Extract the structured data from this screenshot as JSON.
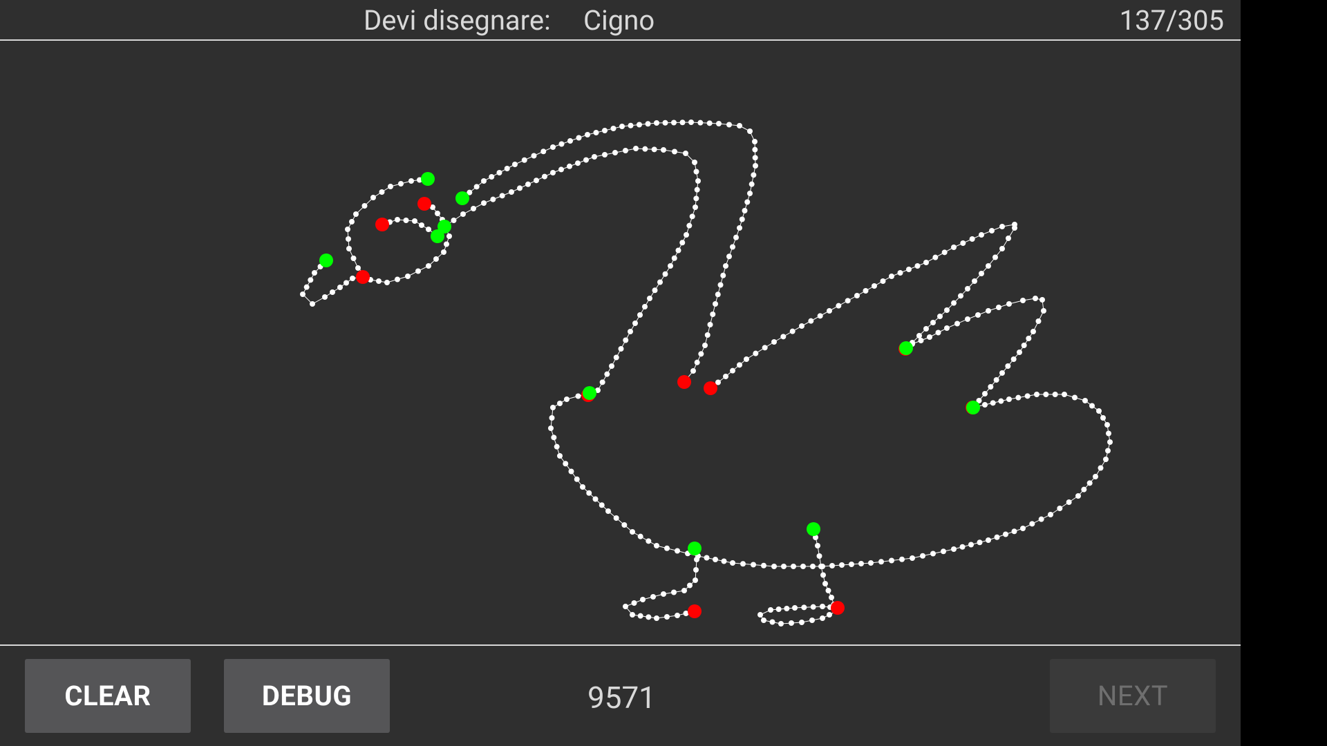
{
  "header": {
    "prompt_label": "Devi disegnare:",
    "prompt_word": "Cigno",
    "progress": "137/305"
  },
  "footer": {
    "clear_label": "CLEAR",
    "debug_label": "DEBUG",
    "score": "9571",
    "next_label": "NEXT"
  },
  "colors": {
    "background": "#2f2f2f",
    "stroke_point": "#ffffff",
    "stroke_start": "#00ff00",
    "stroke_end": "#ff0000"
  },
  "icons": [
    "drawing-canvas"
  ]
}
